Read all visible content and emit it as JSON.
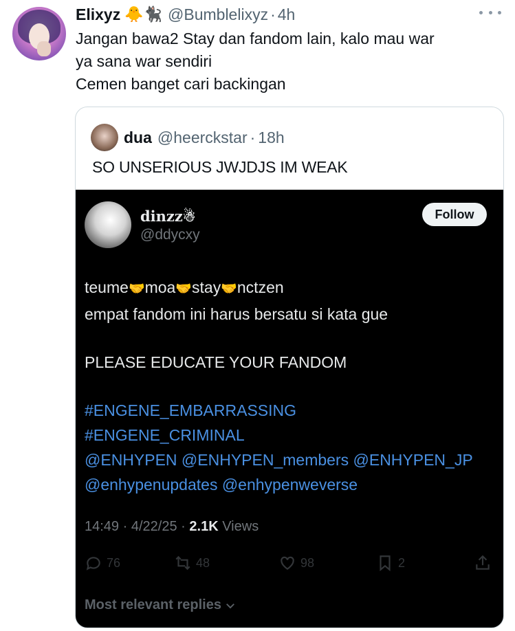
{
  "tweet": {
    "author_name": "Elixyz",
    "author_emoji": "🐥🐈‍⬛",
    "handle": "@Bumblelixyz",
    "separator": "·",
    "time": "4h",
    "text_lines": [
      "Jangan bawa2 Stay dan fandom lain, kalo mau war",
      "ya sana war sendiri",
      "Cemen banget cari backingan"
    ]
  },
  "quote": {
    "author_name": "dua",
    "handle": "@heerckstar",
    "separator": "·",
    "time": "18h",
    "text": "SO UNSERIOUS JWJDJS IM WEAK"
  },
  "screenshot": {
    "author_name": "dinzz☃",
    "handle": "@ddycxy",
    "follow_label": "Follow",
    "body": {
      "line1": [
        "teume",
        "moa",
        "stay",
        "nctzen"
      ],
      "handshake": "🤝",
      "line2": "empat fandom ini harus bersatu si kata gue",
      "line3": "PLEASE EDUCATE YOUR FANDOM",
      "tags": [
        "#ENGENE_EMBARRASSING",
        "#ENGENE_CRIMINAL",
        "@ENHYPEN @ENHYPEN_members @ENHYPEN_JP",
        "@enhypenupdates @enhypenweverse"
      ]
    },
    "meta": {
      "time": "14:49",
      "date": "4/22/25",
      "views_count": "2.1K",
      "views_label": "Views",
      "separator": "·"
    },
    "actions": {
      "replies": "76",
      "reposts": "48",
      "likes": "98",
      "bookmarks": "2"
    },
    "replies_sort_label": "Most relevant replies"
  },
  "icons": {
    "more": "more-horizontal-icon",
    "reply": "reply-icon",
    "repost": "repost-icon",
    "like": "heart-icon",
    "bookmark": "bookmark-icon",
    "share": "share-icon",
    "chevron": "chevron-down-icon"
  },
  "colors": {
    "link_blue": "#4a90e2",
    "secondary_text": "#536471",
    "dark_bg": "#000000"
  }
}
